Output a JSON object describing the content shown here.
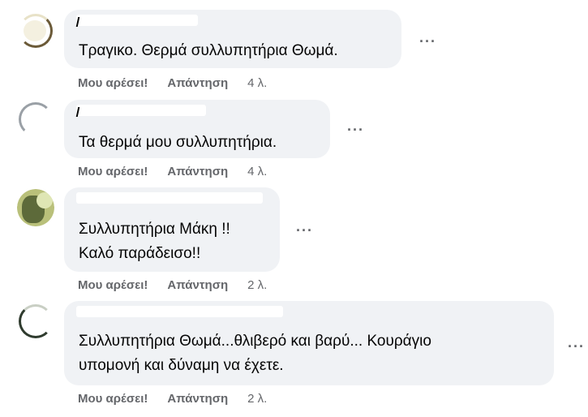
{
  "comments": [
    {
      "lines": [
        "Τραγικο. Θερμά συλλυπητήρια Θωμά."
      ],
      "like": "Μου αρέσει!",
      "reply": "Απάντηση",
      "time": "4 λ."
    },
    {
      "lines": [
        "Τα θερμά μου συλλυπητήρια."
      ],
      "like": "Μου αρέσει!",
      "reply": "Απάντηση",
      "time": "4 λ."
    },
    {
      "lines": [
        "Συλλυπητήρια Μάκη !!",
        "Καλό παράδεισο!!"
      ],
      "like": "Μου αρέσει!",
      "reply": "Απάντηση",
      "time": "2 λ."
    },
    {
      "lines": [
        "Συλλυπητήρια Θωμά...θλιβερό και βαρύ... Κουράγιο",
        "υπομονή και δύναμη να έχετε."
      ],
      "like": "Μου αρέσει!",
      "reply": "Απάντηση",
      "time": "2 λ."
    }
  ],
  "more_icon": "more-options-icon",
  "colors": {
    "bubble": "#f0f2f5",
    "secondary_text": "#65676b",
    "text": "#050505"
  }
}
